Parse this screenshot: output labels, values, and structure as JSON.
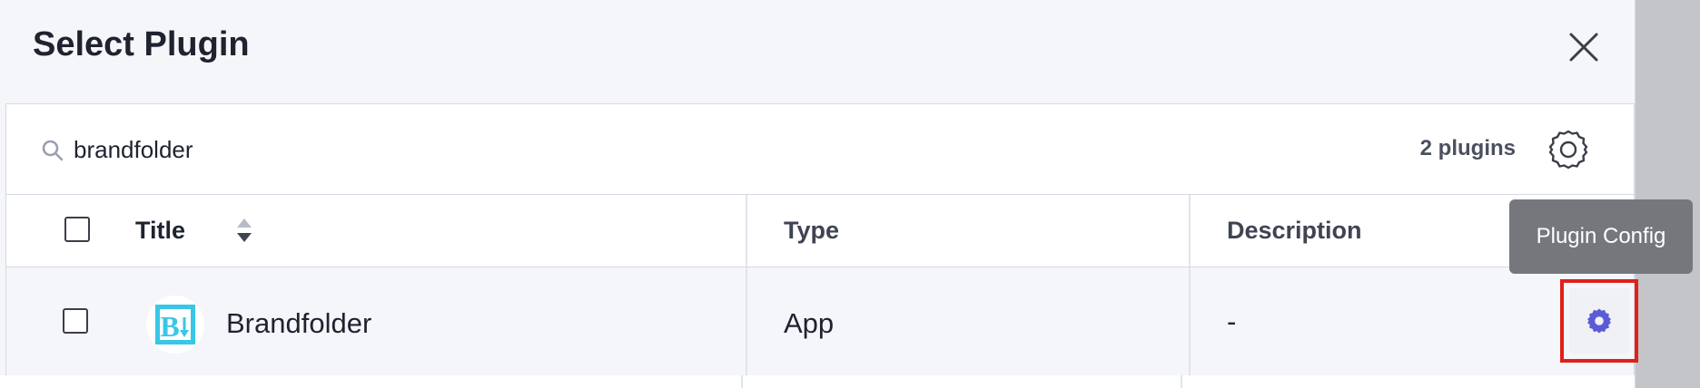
{
  "dialog": {
    "title": "Select Plugin",
    "close_icon": "close-icon"
  },
  "search": {
    "value": "brandfolder",
    "icon": "search-icon",
    "result_count": "2 plugins",
    "settings_icon": "gear-icon"
  },
  "table": {
    "columns": [
      {
        "label": "Title",
        "sortable": true
      },
      {
        "label": "Type"
      },
      {
        "label": "Description"
      }
    ],
    "rows": [
      {
        "title": "Brandfolder",
        "logo_letter": "B",
        "type": "App",
        "description": "-",
        "action_icon": "gear-icon"
      }
    ]
  },
  "tooltip": {
    "text": "Plugin Config"
  },
  "colors": {
    "header_text": "#3f4452",
    "accent": "#5b5bd6",
    "logo": "#38c7e6",
    "highlight": "#e0201b"
  }
}
